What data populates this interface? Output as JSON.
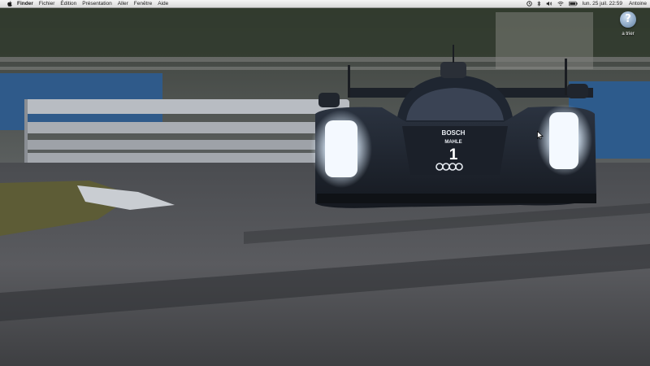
{
  "menubar": {
    "apple_icon": "apple-logo",
    "app_name": "Finder",
    "menus": [
      "Fichier",
      "Édition",
      "Présentation",
      "Aller",
      "Fenêtre",
      "Aide"
    ],
    "status_icons": [
      "time-machine-icon",
      "bluetooth-icon",
      "volume-icon",
      "wifi-icon",
      "battery-icon"
    ],
    "clock": "lun. 25 juil.  22:59",
    "user": "Antoine"
  },
  "desktop": {
    "icon_name": "question-mark-icon",
    "icon_glyph": "?",
    "icon_label": "a trier"
  },
  "wallpaper": {
    "car": {
      "sponsor_top": "BOSCH",
      "sponsor_mid": "MAHLE",
      "number": "1"
    }
  }
}
